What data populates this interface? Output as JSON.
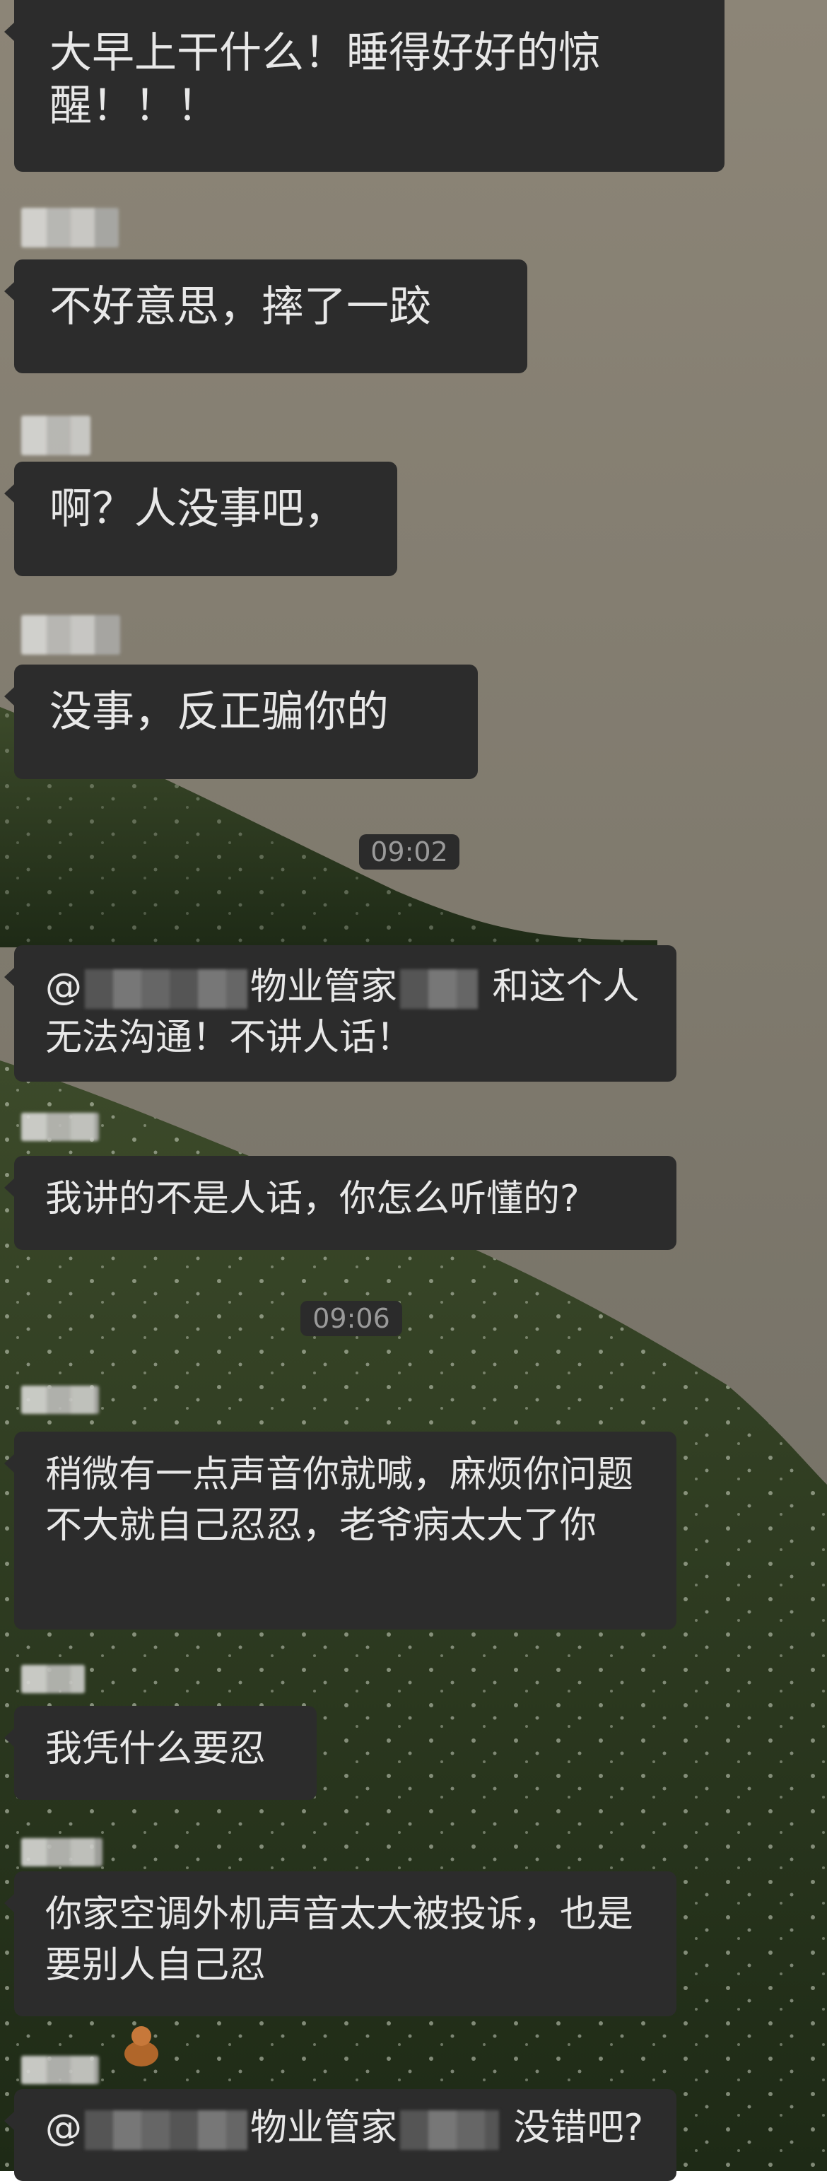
{
  "messages": [
    {
      "id": "m1",
      "text": "大早上干什么！睡得好好的惊醒！！！"
    },
    {
      "id": "m2",
      "text": "不好意思，摔了一跤"
    },
    {
      "id": "m3",
      "text": "啊？人没事吧，"
    },
    {
      "id": "m4",
      "text": "没事，反正骗你的"
    },
    {
      "id": "m5",
      "mention_prefix": "@",
      "mention_role": "物业管家",
      "line1_rest": "和这个人",
      "line2": "无法沟通！不讲人话！"
    },
    {
      "id": "m6",
      "text": "我讲的不是人话，你怎么听懂的?"
    },
    {
      "id": "m7",
      "text": "稍微有一点声音你就喊，麻烦你问题不大就自己忍忍，老爷病太大了你"
    },
    {
      "id": "m8",
      "text": "我凭什么要忍"
    },
    {
      "id": "m9",
      "text": "你家空调外机声音太大被投诉，也是要别人自己忍"
    },
    {
      "id": "m10",
      "mention_prefix": "@",
      "mention_role": "物业管家",
      "rest": "没错吧?"
    }
  ],
  "timestamps": {
    "t1": "09:02",
    "t2": "09:06"
  }
}
